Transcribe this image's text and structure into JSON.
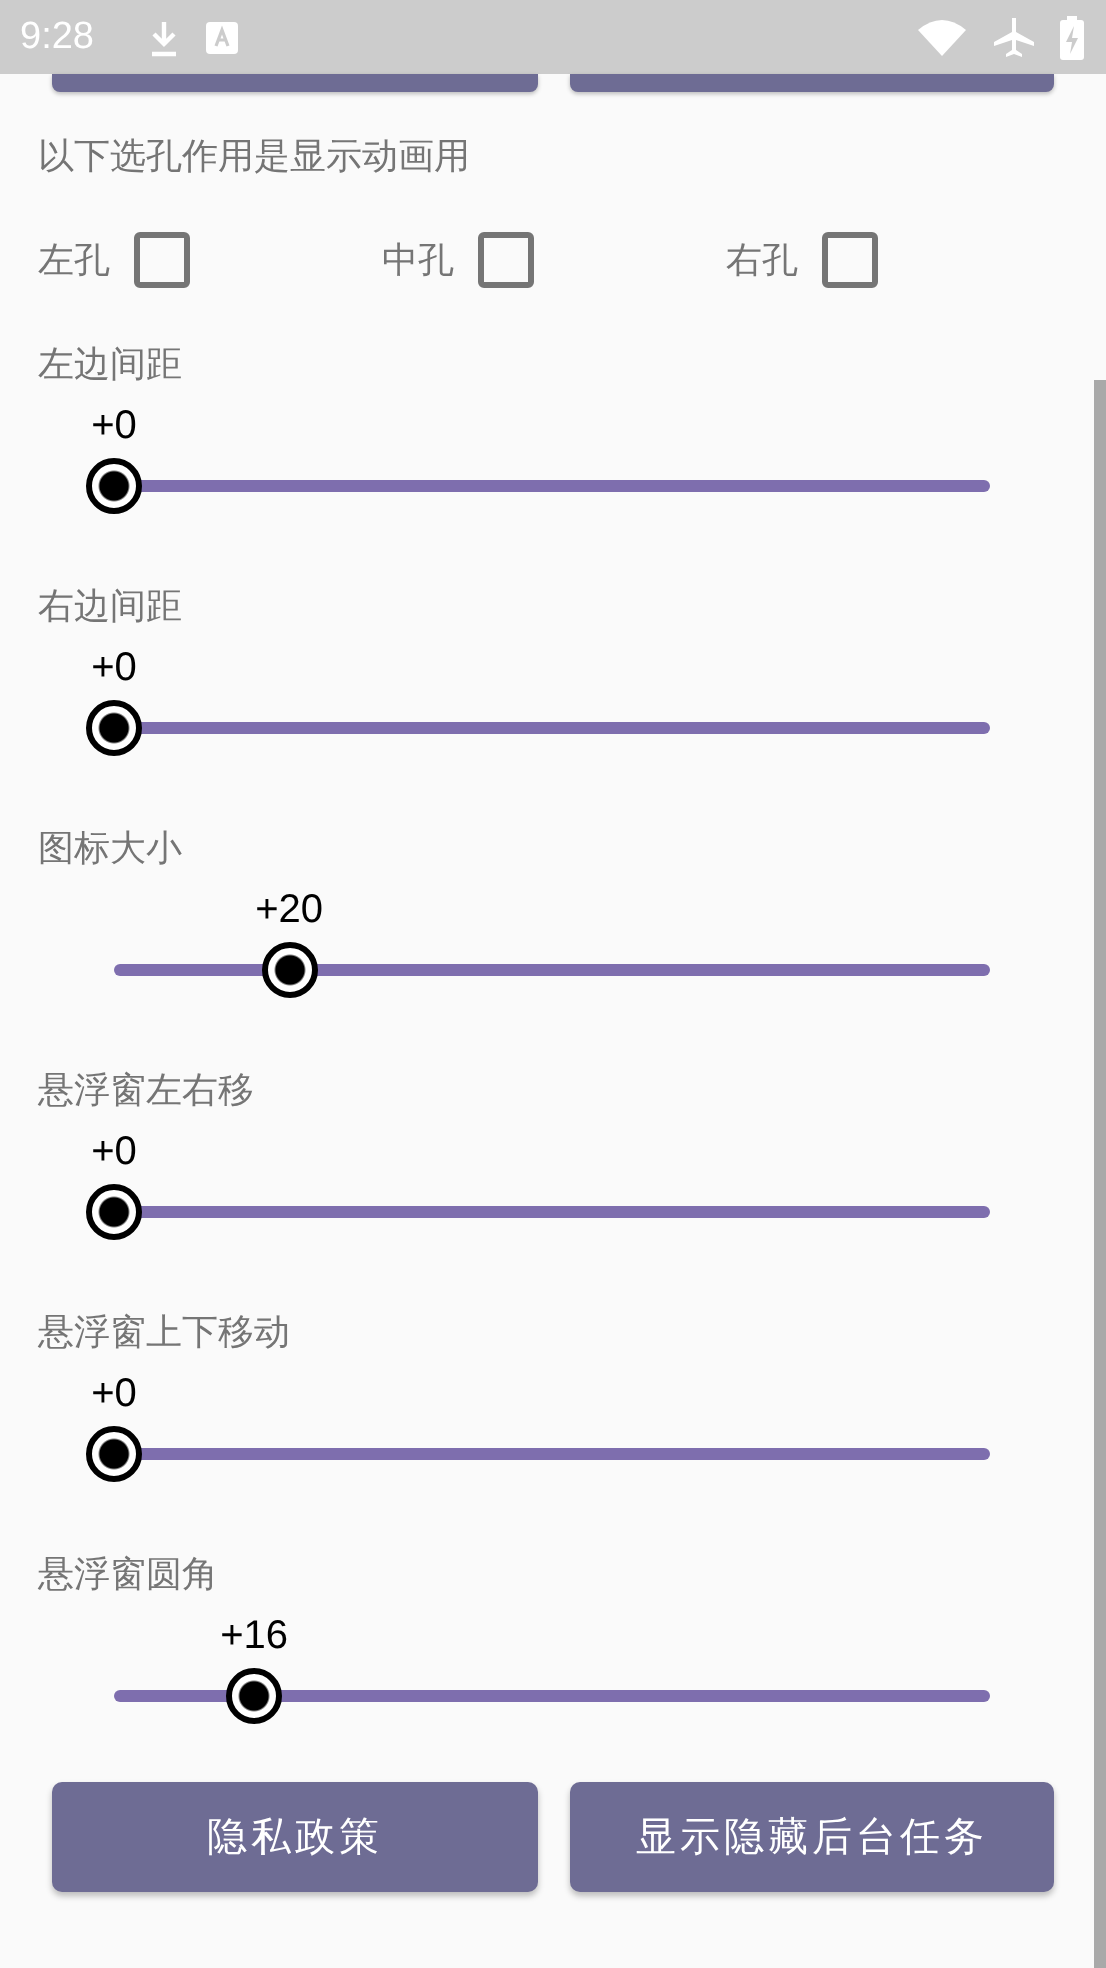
{
  "status_bar": {
    "time": "9:28"
  },
  "notice": "以下选孔作用是显示动画用",
  "holes": [
    {
      "label": "左孔",
      "checked": false
    },
    {
      "label": "中孔",
      "checked": false
    },
    {
      "label": "右孔",
      "checked": false
    }
  ],
  "sliders": [
    {
      "title": "左边间距",
      "reading": "+0",
      "level": 0
    },
    {
      "title": "右边间距",
      "reading": "+0",
      "level": 0
    },
    {
      "title": "图标大小",
      "reading": "+20",
      "level": 0.2
    },
    {
      "title": "悬浮窗左右移",
      "reading": "+0",
      "level": 0
    },
    {
      "title": "悬浮窗上下移动",
      "reading": "+0",
      "level": 0
    },
    {
      "title": "悬浮窗圆角",
      "reading": "+16",
      "level": 0.16
    }
  ],
  "buttons": [
    "隐私政策",
    "显示隐藏后台任务"
  ]
}
